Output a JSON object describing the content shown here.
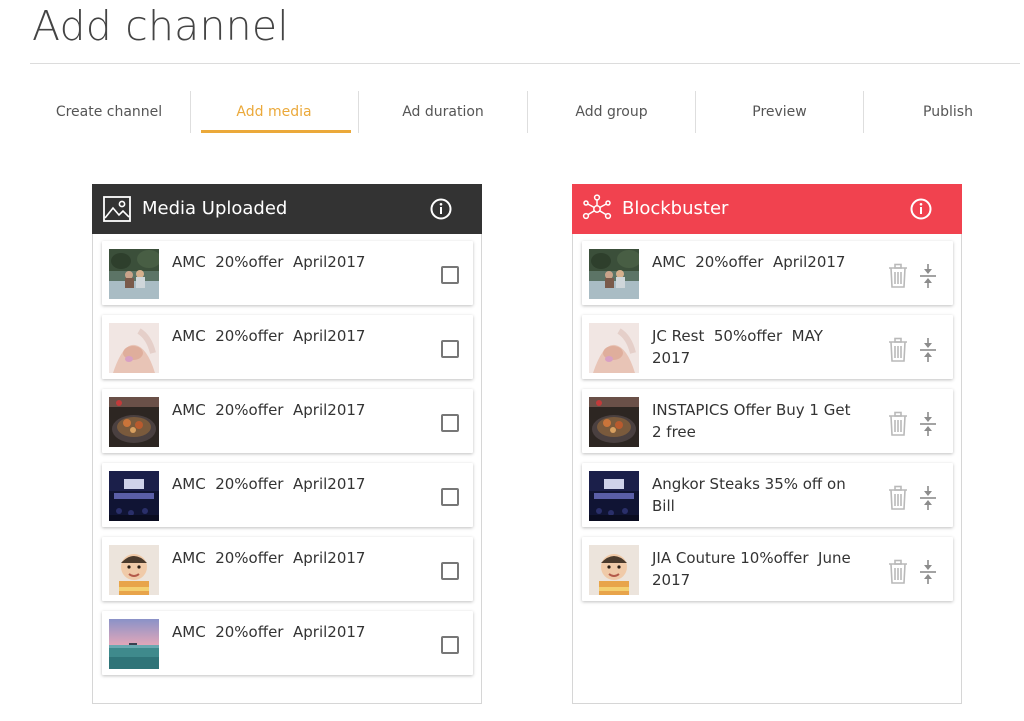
{
  "page": {
    "title": "Add channel"
  },
  "steps": [
    {
      "label": "Create channel",
      "active": false
    },
    {
      "label": "Add media",
      "active": true
    },
    {
      "label": "Ad duration",
      "active": false
    },
    {
      "label": "Add group",
      "active": false
    },
    {
      "label": "Preview",
      "active": false
    },
    {
      "label": "Publish",
      "active": false
    }
  ],
  "colors": {
    "accent": "#eba93a",
    "media_header": "#333333",
    "group_header": "#f1424f"
  },
  "media_panel": {
    "title": "Media Uploaded",
    "icon": "image-icon",
    "info_icon": "info-icon",
    "items": [
      {
        "label": "AMC  20%offer  April2017",
        "thumb": "people-outdoors-thumbnail",
        "checked": false
      },
      {
        "label": "AMC  20%offer  April2017",
        "thumb": "holding-hands-thumbnail",
        "checked": false
      },
      {
        "label": "AMC  20%offer  April2017",
        "thumb": "grilled-food-thumbnail",
        "checked": false
      },
      {
        "label": "AMC  20%offer  April2017",
        "thumb": "concert-stage-thumbnail",
        "checked": false
      },
      {
        "label": "AMC  20%offer  April2017",
        "thumb": "baby-thumbnail",
        "checked": false
      },
      {
        "label": "AMC  20%offer  April2017",
        "thumb": "sea-sunset-thumbnail",
        "checked": false
      }
    ]
  },
  "group_panel": {
    "title": "Blockbuster",
    "icon": "network-icon",
    "info_icon": "info-icon",
    "items": [
      {
        "label": "AMC  20%offer  April2017",
        "thumb": "people-outdoors-thumbnail"
      },
      {
        "label": "JC Rest  50%offer  MAY 2017",
        "thumb": "holding-hands-thumbnail"
      },
      {
        "label": "INSTAPICS Offer Buy 1 Get 2 free",
        "thumb": "grilled-food-thumbnail"
      },
      {
        "label": "Angkor Steaks 35% off on Bill",
        "thumb": "concert-stage-thumbnail"
      },
      {
        "label": "JIA Couture 10%offer  June 2017",
        "thumb": "baby-thumbnail"
      }
    ]
  }
}
